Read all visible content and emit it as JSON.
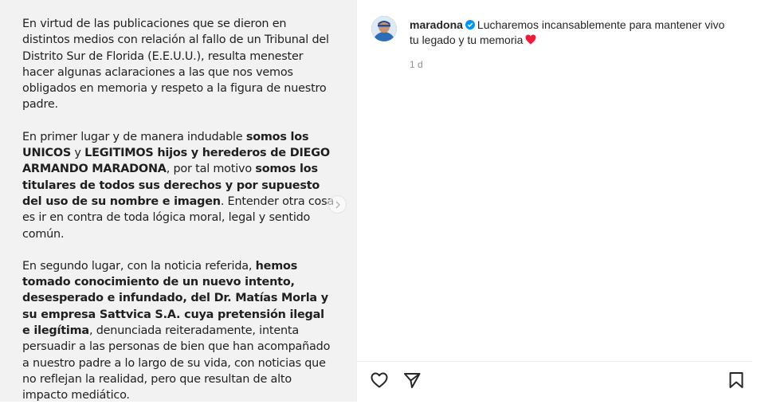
{
  "post": {
    "paragraph1": "En virtud de las publicaciones que se dieron en distintos medios con relación al fallo de un Tribunal del Distrito Sur de Florida (E.E.U.U.), resulta menester hacer algunas aclaraciones a las que nos vemos obligados en memoria y respeto a la figura de nuestro padre.",
    "paragraph2": [
      {
        "text": "En primer lugar y de manera indudable ",
        "bold": false
      },
      {
        "text": "somos los UNICOS",
        "bold": true
      },
      {
        "text": " y ",
        "bold": false
      },
      {
        "text": "LEGITIMOS hijos y herederos de DIEGO ARMANDO MARADONA",
        "bold": true
      },
      {
        "text": ", por tal motivo ",
        "bold": false
      },
      {
        "text": "somos los titulares de todos sus derechos y por supuesto del uso de su nombre e imagen",
        "bold": true
      },
      {
        "text": ". Entender otra cosa es ir en contra de toda lógica moral, legal y sentido común.",
        "bold": false
      }
    ],
    "paragraph3": [
      {
        "text": "En segundo lugar, con la noticia referida, ",
        "bold": false
      },
      {
        "text": "hemos tomado conocimiento de un nuevo intento, desesperado e infundado, del Dr. Matías Morla y su empresa Sattvica S.A. cuya pretensión ilegal e ilegítima",
        "bold": true
      },
      {
        "text": ", denunciada reiteradamente, intenta persuadir a las personas de bien que han acompañado a nuestro padre a lo largo de su vida, con noticias que no reflejan la realidad, pero que resultan de alto impacto mediático.",
        "bold": false
      }
    ]
  },
  "caption": {
    "username": "maradona",
    "text": "Lucharemos incansablemente para mantener vivo tu legado y tu memoria",
    "emoji": "red-heart-emoji",
    "timestamp": "1 d"
  },
  "icons": {
    "next": "chevron-right-icon",
    "like": "heart-outline-icon",
    "share": "paper-plane-icon",
    "save": "bookmark-icon",
    "verified": "verified-badge-icon"
  },
  "colors": {
    "verified": "#0095f6",
    "heart": "#ed1c3b",
    "muted": "#8e8e8e"
  }
}
